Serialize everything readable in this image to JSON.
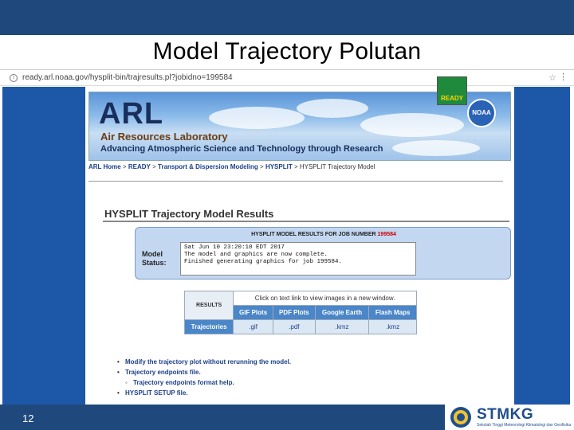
{
  "slide": {
    "title": "Model Trajectory Polutan",
    "page_number": "12",
    "logo_text": "STMKG",
    "logo_subtext": "Sekolah Tinggi Meteorologi Klimatologi dan Geofisika"
  },
  "browser": {
    "url": "ready.arl.noaa.gov/hysplit-bin/trajresults.pl?jobidno=199584"
  },
  "site": {
    "logo": "ARL",
    "full_name": "Air Resources Laboratory",
    "tagline": "Advancing Atmospheric Science and Technology through Research",
    "noaa_badge": "NOAA",
    "ready_logo": "READY",
    "breadcrumb": [
      "ARL Home",
      "READY",
      "Transport & Dispersion Modeling",
      "HYSPLIT",
      "HYSPLIT Trajectory Model"
    ]
  },
  "results": {
    "title": "HYSPLIT Trajectory Model Results",
    "job_prefix": "HYSPLIT MODEL RESULTS FOR JOB NUMBER",
    "job_number": "199584",
    "model_status_label": "Model\nStatus:",
    "status_text": "Sat Jun 10 23:20:10 EDT 2017\nThe model and graphics are now complete.\nFinished generating graphics for job 199584."
  },
  "table": {
    "results_label": "RESULTS",
    "click_text": "Click on text link to view images in a new window.",
    "headers": [
      "GIF Plots",
      "PDF Plots",
      "Google Earth",
      "Flash Maps"
    ],
    "row_label": "Trajectories",
    "links": [
      ".gif",
      ".pdf",
      ".kmz",
      ".kmz"
    ]
  },
  "links": {
    "modify": "Modify the trajectory plot without rerunning the model.",
    "endpoints": "Trajectory endpoints file.",
    "endpoints_format": "Trajectory endpoints format help.",
    "setup": "HYSPLIT SETUP file."
  }
}
